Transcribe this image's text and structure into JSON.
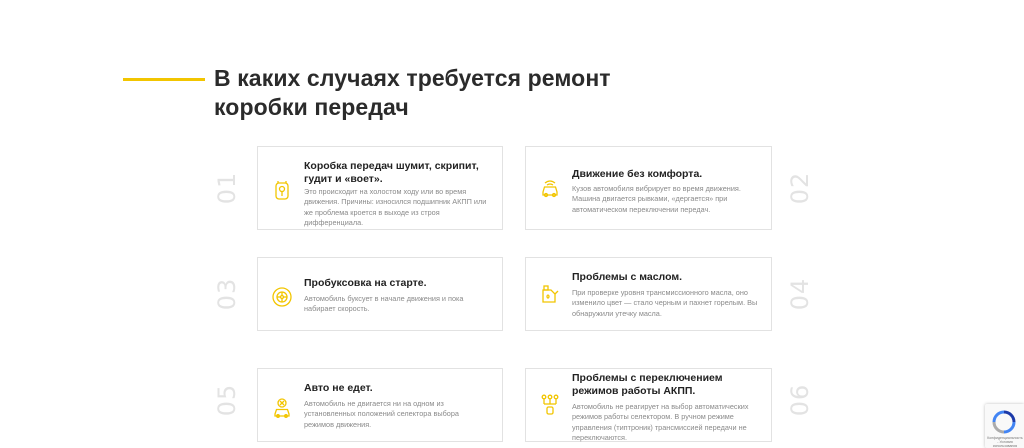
{
  "section": {
    "title_line1": "В каких случаях требуется ремонт",
    "title_line2": "коробки передач",
    "accent_color": "#f2c500"
  },
  "cards": [
    {
      "number": "01",
      "title": "Коробка передач шумит, скрипит, гудит и «воет».",
      "description": "Это происходит на холостом ходу или во время движения. Причины: износился подшипник АКПП или же проблема кроется в выходе из строя дифференциала.",
      "icon": "gearbox-icon"
    },
    {
      "number": "02",
      "title": "Движение без комфорта.",
      "description": "Кузов автомобиля вибрирует во время движения. Машина двигается рывками, «дергается» при автоматическом переключении передач.",
      "icon": "car-vibration-icon"
    },
    {
      "number": "03",
      "title": "Пробуксовка на старте.",
      "description": "Автомобиль буксует в начале движения и пока набирает скорость.",
      "icon": "wheel-icon"
    },
    {
      "number": "04",
      "title": "Проблемы с маслом.",
      "description": "При проверке уровня трансмиссионного масла, оно изменило цвет — стало черным и пахнет горелым. Вы обнаружили утечку масла.",
      "icon": "oil-canister-icon"
    },
    {
      "number": "05",
      "title": "Авто не едет.",
      "description": "Автомобиль не двигается ни на одном из установленных положений селектора выбора режимов движения.",
      "icon": "car-stop-icon"
    },
    {
      "number": "06",
      "title": "Проблемы с переключением режимов работы АКПП.",
      "description": "Автомобиль не реагирует на выбор автоматических режимов работы селектором. В ручном режиме управления (типтроник) трансмиссией передачи не переключаются.",
      "icon": "gear-selector-icon"
    }
  ],
  "recaptcha": {
    "text": "Конфиденциальность - Условия использования"
  }
}
